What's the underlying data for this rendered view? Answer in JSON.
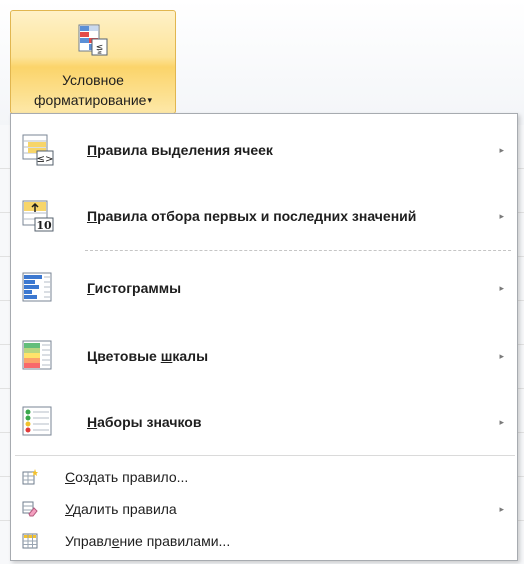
{
  "ribbon": {
    "button": {
      "label_line1": "Условное",
      "label_line2": "форматирование",
      "dropdown_arrow": "▾",
      "icon": "conditional-formatting-icon"
    }
  },
  "menu": {
    "submenu_arrow": "▸",
    "big_items": [
      {
        "label": "Правила выделения ячеек",
        "accel": "П",
        "icon": "highlight-cells-rules-icon",
        "has_submenu": true
      },
      {
        "label": "Правила отбора первых и последних значений",
        "accel": "П",
        "icon": "top-bottom-rules-icon",
        "has_submenu": true
      },
      {
        "label": "Гистограммы",
        "accel": "Г",
        "icon": "data-bars-icon",
        "has_submenu": true
      },
      {
        "label": "Цветовые шкалы",
        "accel": "ш",
        "icon": "color-scales-icon",
        "has_submenu": true
      },
      {
        "label": "Наборы значков",
        "accel": "Н",
        "icon": "icon-sets-icon",
        "has_submenu": true
      }
    ],
    "small_items": [
      {
        "label": "Создать правило...",
        "accel": "С",
        "icon": "new-rule-icon",
        "has_submenu": false
      },
      {
        "label": "Удалить правила",
        "accel": "У",
        "icon": "clear-rules-icon",
        "has_submenu": true
      },
      {
        "label": "Управление правилами...",
        "accel": "е",
        "icon": "manage-rules-icon",
        "has_submenu": false
      }
    ]
  },
  "colors": {
    "ribbon_hover_border": "#e1b650",
    "ribbon_hover_fill": "#fde49a",
    "menu_border": "#a7abb0",
    "text": "#1e1e1e"
  }
}
